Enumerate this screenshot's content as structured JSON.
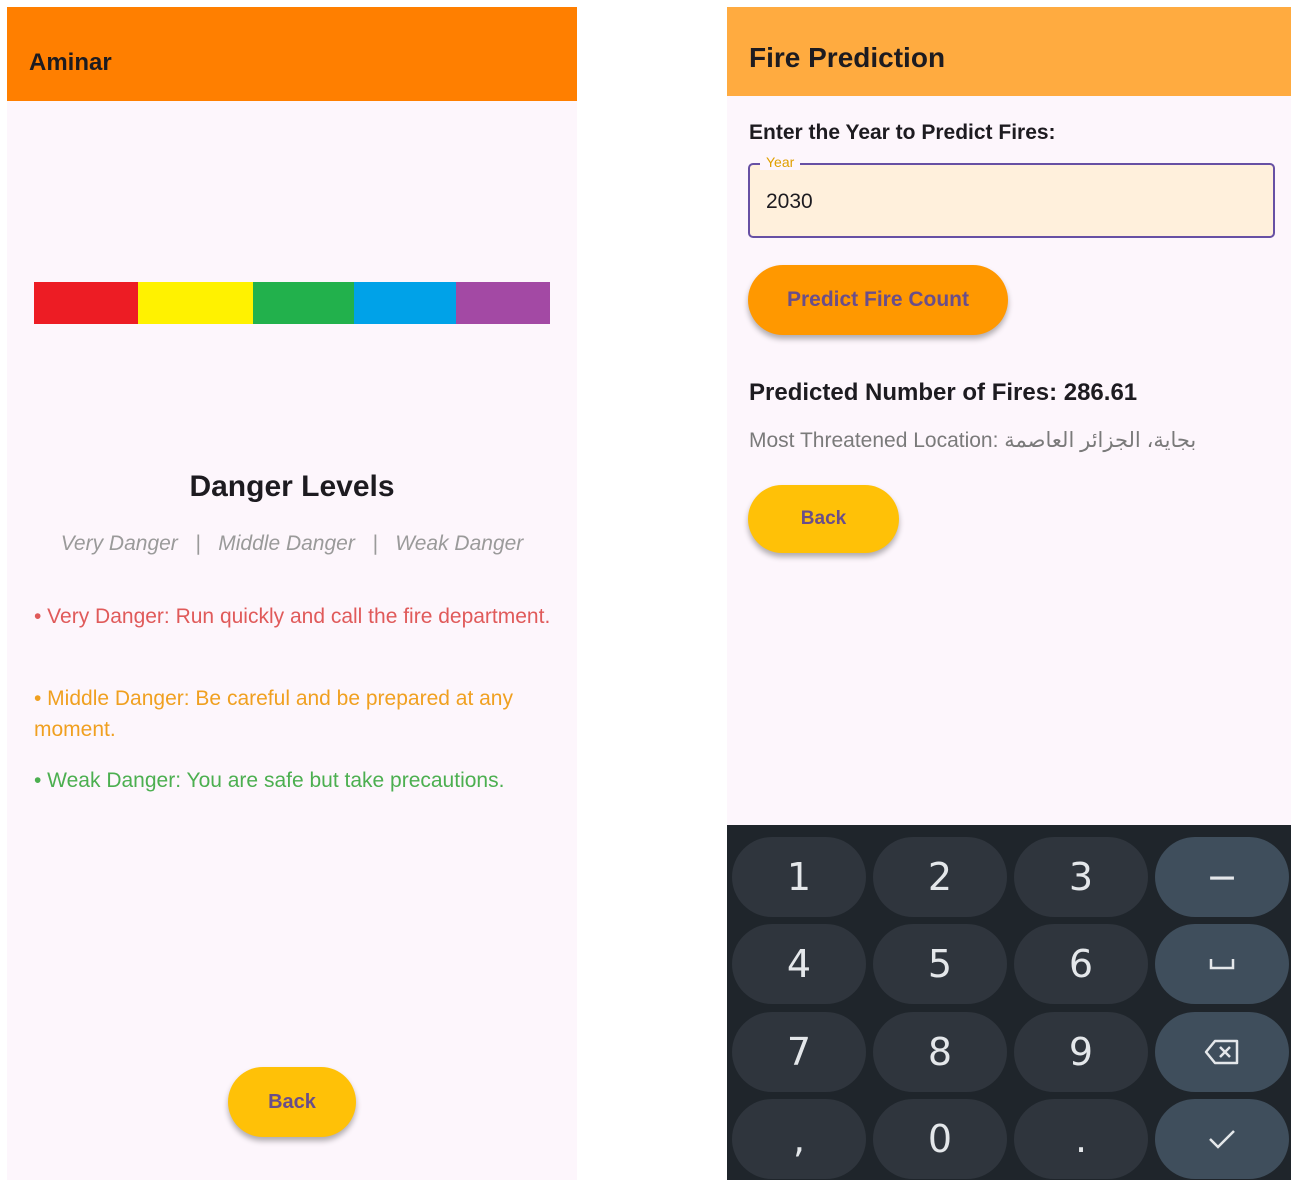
{
  "left_screen": {
    "app_title": "Aminar",
    "danger_colors": [
      "#ed1c24",
      "#fff200",
      "#22b14c",
      "#00a2e8",
      "#a349a4"
    ],
    "danger_title": "Danger Levels",
    "danger_subtitle": "Very Danger   |   Middle Danger   |   Weak Danger",
    "descriptions": [
      {
        "text": "• Very Danger: Run quickly and call the fire department.",
        "color": "#e05a5a"
      },
      {
        "text": "• Middle Danger: Be careful and be prepared at any moment.",
        "color": "#f0a020"
      },
      {
        "text": "• Weak Danger: You are safe but take precautions.",
        "color": "#4caf50"
      }
    ],
    "back_label": "Back"
  },
  "right_screen": {
    "app_title": "Fire Prediction",
    "enter_label": "Enter the Year to Predict Fires:",
    "year_field": {
      "label": "Year",
      "value": "2030"
    },
    "predict_button": "Predict Fire Count",
    "predicted_text": "Predicted Number of Fires: 286.61",
    "location_prefix": "Most Threatened Location:",
    "location_value": "بجاية، الجزائر العاصمة",
    "back_label": "Back"
  },
  "keyboard": {
    "keys": [
      [
        "1",
        "2",
        "3",
        "−"
      ],
      [
        "4",
        "5",
        "6",
        "space-icon"
      ],
      [
        "7",
        "8",
        "9",
        "backspace-icon"
      ],
      [
        ",",
        "0",
        ".",
        "check-icon"
      ]
    ]
  }
}
